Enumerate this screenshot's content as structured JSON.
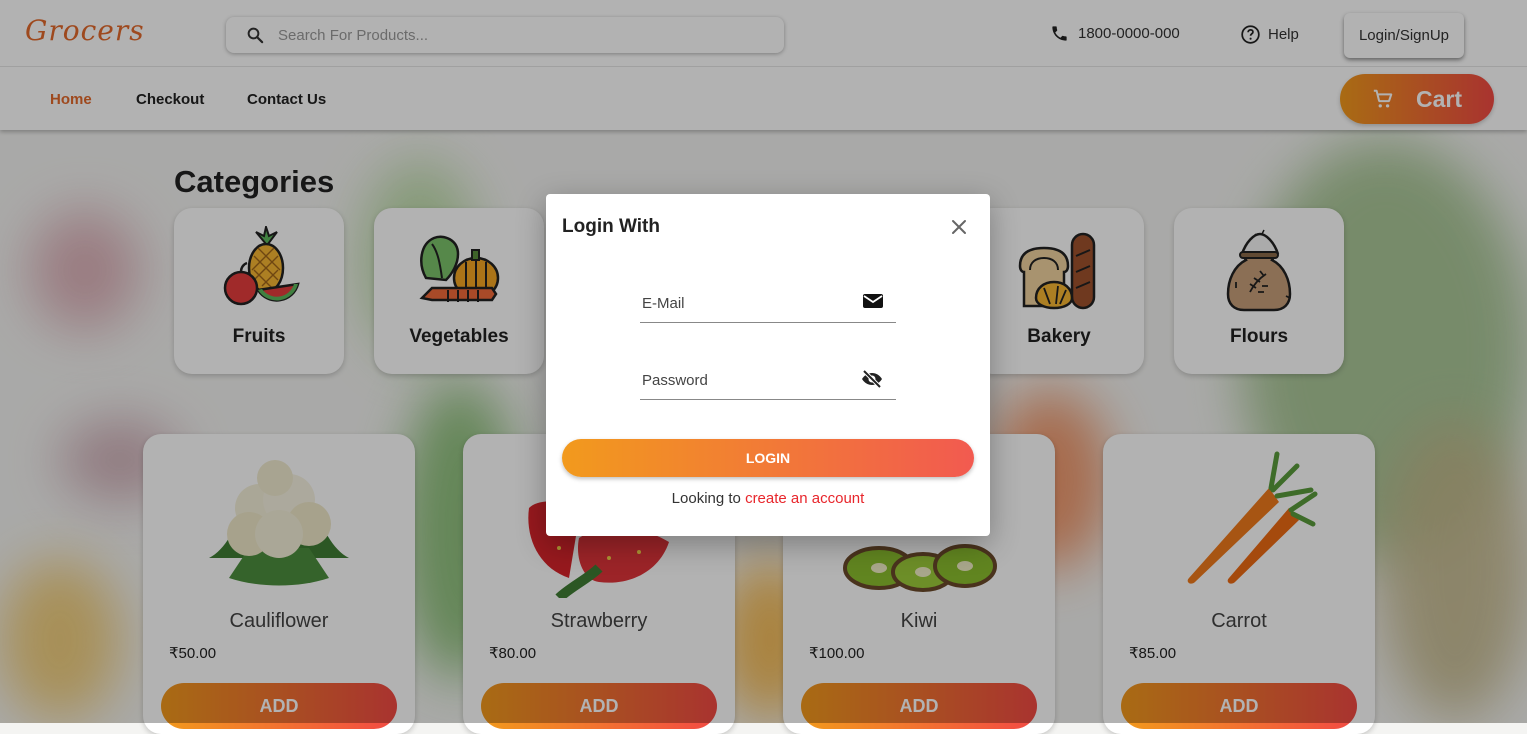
{
  "header": {
    "logo": "Grocers",
    "search_placeholder": "Search For Products...",
    "phone": "1800-0000-000",
    "help": "Help",
    "login_signup": "Login/SignUp"
  },
  "nav": {
    "home": "Home",
    "checkout": "Checkout",
    "contact": "Contact Us",
    "cart": "Cart"
  },
  "categories": {
    "title": "Categories",
    "items": [
      {
        "label": "Fruits"
      },
      {
        "label": "Vegetables"
      },
      {
        "label": ""
      },
      {
        "label": ""
      },
      {
        "label": "Bakery"
      },
      {
        "label": "Flours"
      }
    ]
  },
  "products": [
    {
      "name": "Cauliflower",
      "price": "₹50.00",
      "add": "ADD"
    },
    {
      "name": "Strawberry",
      "price": "₹80.00",
      "add": "ADD"
    },
    {
      "name": "Kiwi",
      "price": "₹100.00",
      "add": "ADD"
    },
    {
      "name": "Carrot",
      "price": "₹85.00",
      "add": "ADD"
    }
  ],
  "dialog": {
    "title": "Login With",
    "email_placeholder": "E-Mail",
    "password_placeholder": "Password",
    "login_button": "LOGIN",
    "footer_prefix": "Looking to ",
    "footer_link": "create an account"
  },
  "colors": {
    "brand": "#e3692b",
    "gradient_start": "#f29a1d",
    "gradient_end": "#f24a44",
    "link": "#e8262c"
  }
}
